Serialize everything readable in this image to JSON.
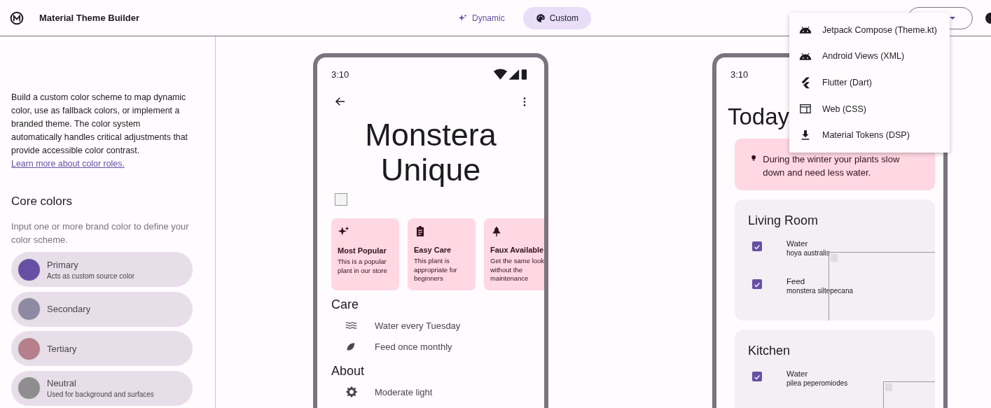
{
  "header": {
    "title": "Material Theme Builder",
    "modes": [
      {
        "label": "Dynamic",
        "selected": false
      },
      {
        "label": "Custom",
        "selected": true
      }
    ]
  },
  "sidebar": {
    "intro": "Build a custom color scheme to map dynamic color, use as fallback colors, or implement a branded theme. The color system automatically handles critical adjustments that provide accessible color contrast.",
    "intro_link": "Learn more about color roles.",
    "heading": "Core colors",
    "hint": "Input one or more brand color to define your color scheme.",
    "colors": [
      {
        "name": "Primary",
        "description": "Acts as custom source color",
        "color": "#6750a4"
      },
      {
        "name": "Secondary",
        "color": "#8e8aa4"
      },
      {
        "name": "Tertiary",
        "color": "#b5808b"
      },
      {
        "name": "Neutral",
        "description": "Used for background and surfaces",
        "color": "#908d90"
      }
    ]
  },
  "phone_detail": {
    "time": "3:10",
    "title": "Monstera Unique",
    "cards": [
      {
        "title": "Most Popular",
        "text": "This is a popular plant in our store"
      },
      {
        "title": "Easy Care",
        "text": "This plant is appropriate for beginners"
      },
      {
        "title": "Faux Available",
        "text": "Get the same look without the maintenance"
      }
    ],
    "sections": [
      {
        "heading": "Care",
        "items": [
          "Water every Tuesday",
          "Feed once monthly"
        ]
      },
      {
        "heading": "About",
        "items": [
          "Moderate light"
        ]
      }
    ]
  },
  "phone_today": {
    "time": "3:10",
    "title": "Today",
    "tip": "During the winter your plants slow down and need less water.",
    "rooms": [
      {
        "name": "Living Room",
        "tasks": [
          {
            "label": "Water",
            "plant": "hoya australis",
            "checked": true
          },
          {
            "label": "Feed",
            "plant": "monstera siltepecana",
            "checked": true
          }
        ]
      },
      {
        "name": "Kitchen",
        "tasks": [
          {
            "label": "Water",
            "plant": "pilea peperomiodes",
            "checked": true
          }
        ]
      }
    ]
  },
  "export_menu": {
    "items": [
      "Jetpack Compose (Theme.kt)",
      "Android Views (XML)",
      "Flutter (Dart)",
      "Web (CSS)",
      "Material Tokens (DSP)"
    ]
  }
}
